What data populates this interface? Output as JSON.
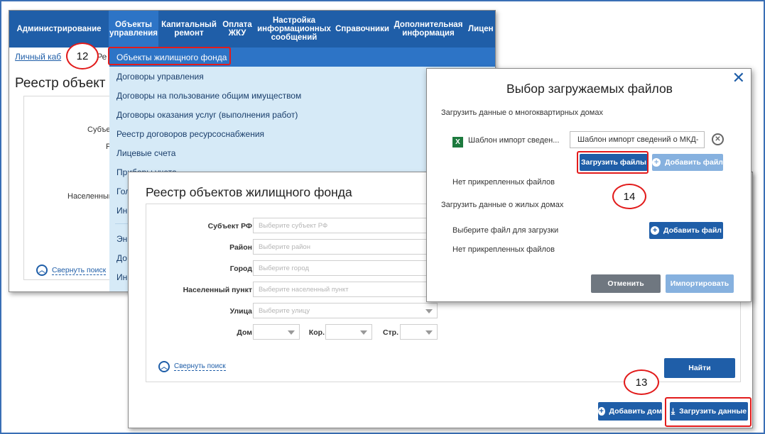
{
  "portal": {
    "nav": [
      {
        "label": "Администрирование"
      },
      {
        "label": "Объекты\nуправления"
      },
      {
        "label": "Капитальный\nремонт"
      },
      {
        "label": "Оплата\nЖКУ"
      },
      {
        "label": "Настройка\nинформационных\nсообщений"
      },
      {
        "label": "Справочники"
      },
      {
        "label": "Дополнительная\nинформация"
      },
      {
        "label": "Лицен"
      }
    ],
    "breadcrumb_link": "Личный каб",
    "breadcrumb_rest": "Ре",
    "page_title": "Реестр объект",
    "bg_labels": {
      "subject": "Субъе",
      "region": "Р",
      "settlement": "Населенный",
      "collapse": "Свернуть поиск"
    },
    "menu": [
      "Объекты жилищного фонда",
      "Договоры управления",
      "Договоры на пользование общим имуществом",
      "Договоры оказания услуг (выполнения работ)",
      "Реестр договоров ресурсоснабжения",
      "Лицевые счета",
      "Приборы учета",
      "Гол",
      "Ин",
      "Эн",
      "До",
      "Ин"
    ]
  },
  "registry": {
    "title": "Реестр объектов жилищного фонда",
    "fields": {
      "subject_label": "Субъект РФ",
      "subject_placeholder": "Выберите субъект РФ",
      "district_label": "Район",
      "district_placeholder": "Выберите район",
      "city_label": "Город",
      "city_placeholder": "Выберите город",
      "settlement_label": "Населенный пункт",
      "settlement_placeholder": "Выберите населенный пункт",
      "street_label": "Улица",
      "street_placeholder": "Выберите улицу",
      "house_label": "Дом",
      "building_label": "Кор.",
      "structure_label": "Стр."
    },
    "collapse": "Свернуть поиск",
    "find_button": "Найти",
    "add_house_button": "Добавить дом",
    "upload_data_button": "Загрузить данные"
  },
  "modal": {
    "title": "Выбор загружаемых файлов",
    "section1": "Загрузить данные о многоквартирных домах",
    "file_name": "Шаблон импорт сведен...",
    "file_input_value": "Шаблон импорт сведений о МКД-",
    "upload_files_button": "Загрузить файлы",
    "add_file_button_1": "Добавить файл",
    "no_files_1": "Нет прикрепленных файлов",
    "section2": "Загрузить данные о жилых домах",
    "choose_file": "Выберите файл для загрузки",
    "add_file_button_2": "Добавить файл",
    "no_files_2": "Нет прикрепленных файлов",
    "cancel_button": "Отменить",
    "import_button": "Импортировать"
  },
  "callouts": {
    "c12": "12",
    "c13": "13",
    "c14": "14"
  },
  "colors": {
    "brand": "#1f5ea8",
    "highlight": "#e21b1b",
    "menu_bg": "#d6eaf7",
    "excel": "#1d7a3e"
  }
}
